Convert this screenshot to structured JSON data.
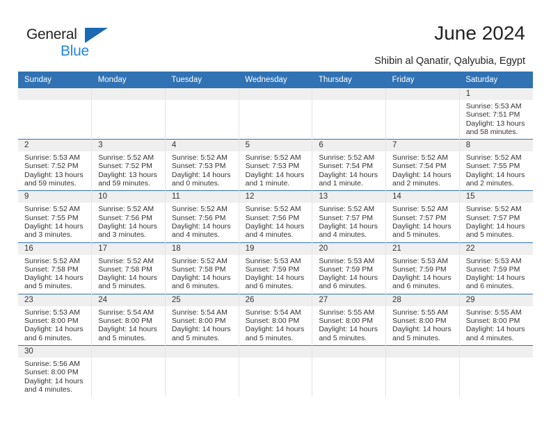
{
  "brand": {
    "name_part1": "General",
    "name_part2": "Blue",
    "accent_color": "#2288dd",
    "triangle_color": "#1b69b2"
  },
  "header": {
    "title": "June 2024",
    "location": "Shibin al Qanatir, Qalyubia, Egypt"
  },
  "calendar": {
    "header_bg": "#3072b3",
    "daynum_bg": "#efefef",
    "weekday_headers": [
      "Sunday",
      "Monday",
      "Tuesday",
      "Wednesday",
      "Thursday",
      "Friday",
      "Saturday"
    ],
    "weeks": [
      [
        {
          "day": "",
          "lines": []
        },
        {
          "day": "",
          "lines": []
        },
        {
          "day": "",
          "lines": []
        },
        {
          "day": "",
          "lines": []
        },
        {
          "day": "",
          "lines": []
        },
        {
          "day": "",
          "lines": []
        },
        {
          "day": "1",
          "lines": [
            "Sunrise: 5:53 AM",
            "Sunset: 7:51 PM",
            "Daylight: 13 hours",
            "and 58 minutes."
          ]
        }
      ],
      [
        {
          "day": "2",
          "lines": [
            "Sunrise: 5:53 AM",
            "Sunset: 7:52 PM",
            "Daylight: 13 hours",
            "and 59 minutes."
          ]
        },
        {
          "day": "3",
          "lines": [
            "Sunrise: 5:52 AM",
            "Sunset: 7:52 PM",
            "Daylight: 13 hours",
            "and 59 minutes."
          ]
        },
        {
          "day": "4",
          "lines": [
            "Sunrise: 5:52 AM",
            "Sunset: 7:53 PM",
            "Daylight: 14 hours",
            "and 0 minutes."
          ]
        },
        {
          "day": "5",
          "lines": [
            "Sunrise: 5:52 AM",
            "Sunset: 7:53 PM",
            "Daylight: 14 hours",
            "and 1 minute."
          ]
        },
        {
          "day": "6",
          "lines": [
            "Sunrise: 5:52 AM",
            "Sunset: 7:54 PM",
            "Daylight: 14 hours",
            "and 1 minute."
          ]
        },
        {
          "day": "7",
          "lines": [
            "Sunrise: 5:52 AM",
            "Sunset: 7:54 PM",
            "Daylight: 14 hours",
            "and 2 minutes."
          ]
        },
        {
          "day": "8",
          "lines": [
            "Sunrise: 5:52 AM",
            "Sunset: 7:55 PM",
            "Daylight: 14 hours",
            "and 2 minutes."
          ]
        }
      ],
      [
        {
          "day": "9",
          "lines": [
            "Sunrise: 5:52 AM",
            "Sunset: 7:55 PM",
            "Daylight: 14 hours",
            "and 3 minutes."
          ]
        },
        {
          "day": "10",
          "lines": [
            "Sunrise: 5:52 AM",
            "Sunset: 7:56 PM",
            "Daylight: 14 hours",
            "and 3 minutes."
          ]
        },
        {
          "day": "11",
          "lines": [
            "Sunrise: 5:52 AM",
            "Sunset: 7:56 PM",
            "Daylight: 14 hours",
            "and 4 minutes."
          ]
        },
        {
          "day": "12",
          "lines": [
            "Sunrise: 5:52 AM",
            "Sunset: 7:56 PM",
            "Daylight: 14 hours",
            "and 4 minutes."
          ]
        },
        {
          "day": "13",
          "lines": [
            "Sunrise: 5:52 AM",
            "Sunset: 7:57 PM",
            "Daylight: 14 hours",
            "and 4 minutes."
          ]
        },
        {
          "day": "14",
          "lines": [
            "Sunrise: 5:52 AM",
            "Sunset: 7:57 PM",
            "Daylight: 14 hours",
            "and 5 minutes."
          ]
        },
        {
          "day": "15",
          "lines": [
            "Sunrise: 5:52 AM",
            "Sunset: 7:57 PM",
            "Daylight: 14 hours",
            "and 5 minutes."
          ]
        }
      ],
      [
        {
          "day": "16",
          "lines": [
            "Sunrise: 5:52 AM",
            "Sunset: 7:58 PM",
            "Daylight: 14 hours",
            "and 5 minutes."
          ]
        },
        {
          "day": "17",
          "lines": [
            "Sunrise: 5:52 AM",
            "Sunset: 7:58 PM",
            "Daylight: 14 hours",
            "and 5 minutes."
          ]
        },
        {
          "day": "18",
          "lines": [
            "Sunrise: 5:52 AM",
            "Sunset: 7:58 PM",
            "Daylight: 14 hours",
            "and 6 minutes."
          ]
        },
        {
          "day": "19",
          "lines": [
            "Sunrise: 5:53 AM",
            "Sunset: 7:59 PM",
            "Daylight: 14 hours",
            "and 6 minutes."
          ]
        },
        {
          "day": "20",
          "lines": [
            "Sunrise: 5:53 AM",
            "Sunset: 7:59 PM",
            "Daylight: 14 hours",
            "and 6 minutes."
          ]
        },
        {
          "day": "21",
          "lines": [
            "Sunrise: 5:53 AM",
            "Sunset: 7:59 PM",
            "Daylight: 14 hours",
            "and 6 minutes."
          ]
        },
        {
          "day": "22",
          "lines": [
            "Sunrise: 5:53 AM",
            "Sunset: 7:59 PM",
            "Daylight: 14 hours",
            "and 6 minutes."
          ]
        }
      ],
      [
        {
          "day": "23",
          "lines": [
            "Sunrise: 5:53 AM",
            "Sunset: 8:00 PM",
            "Daylight: 14 hours",
            "and 6 minutes."
          ]
        },
        {
          "day": "24",
          "lines": [
            "Sunrise: 5:54 AM",
            "Sunset: 8:00 PM",
            "Daylight: 14 hours",
            "and 5 minutes."
          ]
        },
        {
          "day": "25",
          "lines": [
            "Sunrise: 5:54 AM",
            "Sunset: 8:00 PM",
            "Daylight: 14 hours",
            "and 5 minutes."
          ]
        },
        {
          "day": "26",
          "lines": [
            "Sunrise: 5:54 AM",
            "Sunset: 8:00 PM",
            "Daylight: 14 hours",
            "and 5 minutes."
          ]
        },
        {
          "day": "27",
          "lines": [
            "Sunrise: 5:55 AM",
            "Sunset: 8:00 PM",
            "Daylight: 14 hours",
            "and 5 minutes."
          ]
        },
        {
          "day": "28",
          "lines": [
            "Sunrise: 5:55 AM",
            "Sunset: 8:00 PM",
            "Daylight: 14 hours",
            "and 5 minutes."
          ]
        },
        {
          "day": "29",
          "lines": [
            "Sunrise: 5:55 AM",
            "Sunset: 8:00 PM",
            "Daylight: 14 hours",
            "and 4 minutes."
          ]
        }
      ],
      [
        {
          "day": "30",
          "lines": [
            "Sunrise: 5:56 AM",
            "Sunset: 8:00 PM",
            "Daylight: 14 hours",
            "and 4 minutes."
          ]
        },
        {
          "day": "",
          "lines": []
        },
        {
          "day": "",
          "lines": []
        },
        {
          "day": "",
          "lines": []
        },
        {
          "day": "",
          "lines": []
        },
        {
          "day": "",
          "lines": []
        },
        {
          "day": "",
          "lines": []
        }
      ]
    ]
  }
}
